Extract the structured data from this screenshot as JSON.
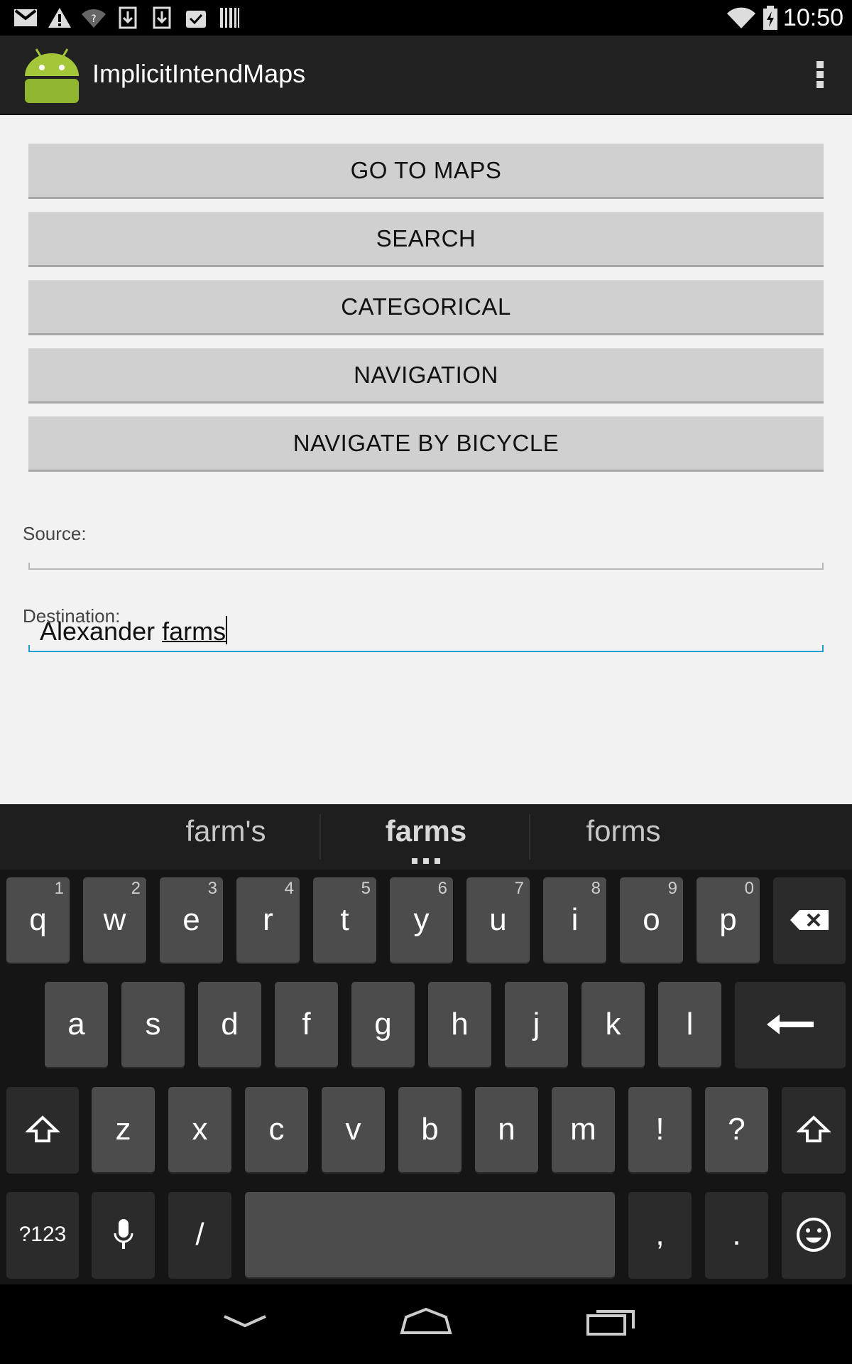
{
  "status_bar": {
    "time": "10:50",
    "left_icons": [
      "gmail-icon",
      "warning-icon",
      "wifi-question-icon",
      "download-icon",
      "download-icon",
      "clipboard-check-icon",
      "barcode-icon"
    ],
    "right_icons": [
      "wifi-icon",
      "battery-charging-icon"
    ]
  },
  "action_bar": {
    "title": "ImplicitIntendMaps",
    "logo_icon": "android-icon",
    "overflow_icon": "overflow-menu-icon"
  },
  "buttons": [
    {
      "label": "GO TO MAPS"
    },
    {
      "label": "SEARCH"
    },
    {
      "label": "CATEGORICAL"
    },
    {
      "label": "NAVIGATION"
    },
    {
      "label": "NAVIGATE BY BICYCLE"
    }
  ],
  "form": {
    "source_label": "Source:",
    "source_value": "",
    "destination_label": "Destination:",
    "destination_value_prefix": "Alexander ",
    "destination_value_composing": "farms"
  },
  "keyboard": {
    "suggestions": [
      "farm's",
      "farms",
      "forms"
    ],
    "row1": [
      {
        "k": "q",
        "h": "1"
      },
      {
        "k": "w",
        "h": "2"
      },
      {
        "k": "e",
        "h": "3"
      },
      {
        "k": "r",
        "h": "4"
      },
      {
        "k": "t",
        "h": "5"
      },
      {
        "k": "y",
        "h": "6"
      },
      {
        "k": "u",
        "h": "7"
      },
      {
        "k": "i",
        "h": "8"
      },
      {
        "k": "o",
        "h": "9"
      },
      {
        "k": "p",
        "h": "0"
      }
    ],
    "row2": [
      "a",
      "s",
      "d",
      "f",
      "g",
      "h",
      "j",
      "k",
      "l"
    ],
    "row3": [
      "z",
      "x",
      "c",
      "v",
      "b",
      "n",
      "m",
      "!",
      "?"
    ],
    "symbols_label": "?123",
    "slash_label": "/",
    "comma_label": ",",
    "period_label": "."
  },
  "colors": {
    "accent": "#1da1d4",
    "button_bg": "#d0d0d0",
    "key_bg": "#4c4c4c",
    "android_green": "#a4c639"
  }
}
